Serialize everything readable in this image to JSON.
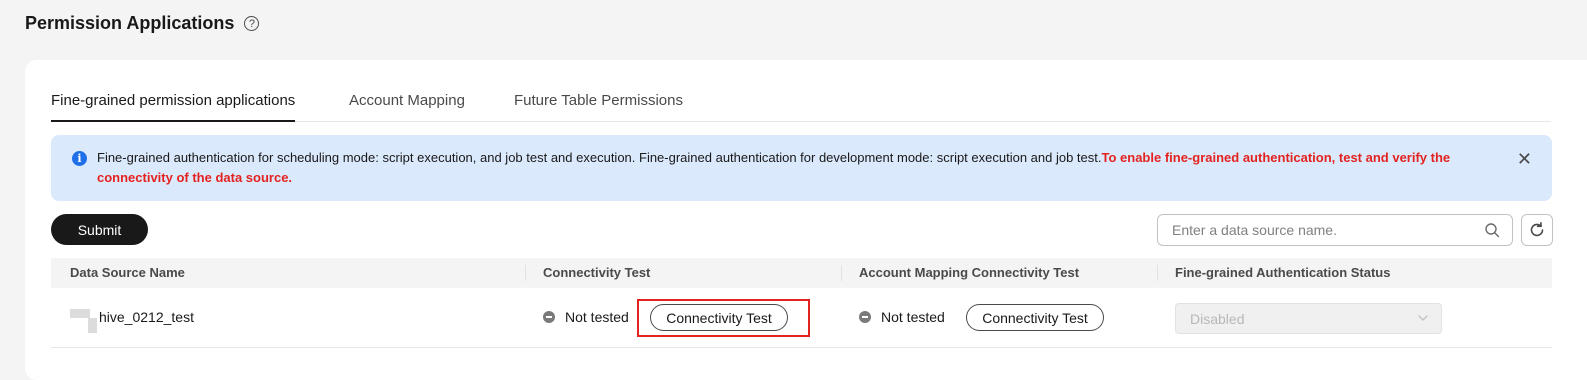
{
  "header": {
    "title": "Permission Applications",
    "help_icon": "?"
  },
  "tabs": [
    {
      "label": "Fine-grained permission applications",
      "active": true
    },
    {
      "label": "Account Mapping",
      "active": false
    },
    {
      "label": "Future Table Permissions",
      "active": false
    }
  ],
  "alert": {
    "icon": "i",
    "text": "Fine-grained authentication for scheduling mode: script execution, and job test and execution. Fine-grained authentication for development mode: script execution and job test.",
    "warning": "To enable fine-grained authentication, test and verify the connectivity of the data source.",
    "close": "✕",
    "warning_color": "#e3231f"
  },
  "toolbar": {
    "submit_label": "Submit",
    "search_placeholder": "Enter a data source name."
  },
  "table": {
    "columns": [
      "Data Source Name",
      "Connectivity Test",
      "Account Mapping Connectivity Test",
      "Fine-grained Authentication Status"
    ],
    "rows": [
      {
        "name": "hive_0212_test",
        "connectivity_status": "Not tested",
        "connectivity_button": "Connectivity Test",
        "mapping_status": "Not tested",
        "mapping_button": "Connectivity Test",
        "auth_status": "Disabled"
      }
    ]
  }
}
